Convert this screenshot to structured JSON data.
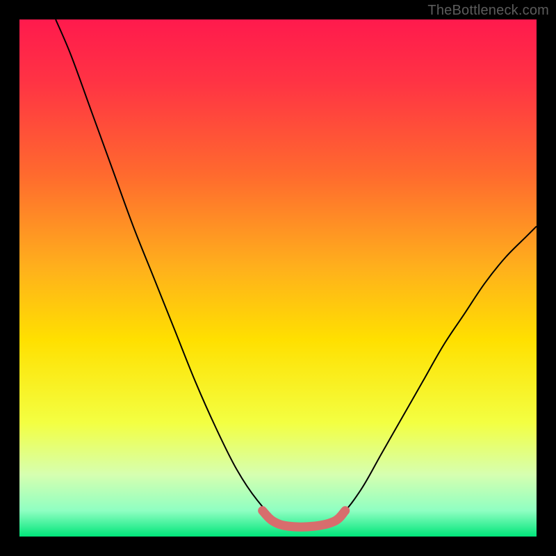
{
  "watermark": "TheBottleneck.com",
  "chart_data": {
    "type": "line",
    "title": "",
    "xlabel": "",
    "ylabel": "",
    "xlim": [
      0,
      100
    ],
    "ylim": [
      0,
      100
    ],
    "grid": false,
    "legend": false,
    "gradient_stops": [
      {
        "offset": 0.0,
        "color": "#ff1a4d"
      },
      {
        "offset": 0.12,
        "color": "#ff3344"
      },
      {
        "offset": 0.3,
        "color": "#ff6a2e"
      },
      {
        "offset": 0.48,
        "color": "#ffb01c"
      },
      {
        "offset": 0.62,
        "color": "#ffe000"
      },
      {
        "offset": 0.78,
        "color": "#f3ff42"
      },
      {
        "offset": 0.88,
        "color": "#d6ffb0"
      },
      {
        "offset": 0.95,
        "color": "#8fffc2"
      },
      {
        "offset": 1.0,
        "color": "#00e57a"
      }
    ],
    "series": [
      {
        "name": "bottleneck-curve",
        "stroke": "#000000",
        "stroke_width": 2,
        "points": [
          {
            "x": 7,
            "y": 100
          },
          {
            "x": 10,
            "y": 93
          },
          {
            "x": 14,
            "y": 82
          },
          {
            "x": 18,
            "y": 71
          },
          {
            "x": 22,
            "y": 60
          },
          {
            "x": 26,
            "y": 50
          },
          {
            "x": 30,
            "y": 40
          },
          {
            "x": 34,
            "y": 30
          },
          {
            "x": 38,
            "y": 21
          },
          {
            "x": 42,
            "y": 13
          },
          {
            "x": 46,
            "y": 7
          },
          {
            "x": 50,
            "y": 3
          },
          {
            "x": 54,
            "y": 2
          },
          {
            "x": 58,
            "y": 2
          },
          {
            "x": 62,
            "y": 4
          },
          {
            "x": 66,
            "y": 9
          },
          {
            "x": 70,
            "y": 16
          },
          {
            "x": 74,
            "y": 23
          },
          {
            "x": 78,
            "y": 30
          },
          {
            "x": 82,
            "y": 37
          },
          {
            "x": 86,
            "y": 43
          },
          {
            "x": 90,
            "y": 49
          },
          {
            "x": 94,
            "y": 54
          },
          {
            "x": 98,
            "y": 58
          },
          {
            "x": 100,
            "y": 60
          }
        ]
      },
      {
        "name": "optimal-zone-highlight",
        "stroke": "#d86d6d",
        "stroke_width": 13,
        "stroke_linecap": "round",
        "points": [
          {
            "x": 47,
            "y": 5
          },
          {
            "x": 49,
            "y": 3
          },
          {
            "x": 52,
            "y": 2
          },
          {
            "x": 57,
            "y": 2
          },
          {
            "x": 61,
            "y": 3
          },
          {
            "x": 63,
            "y": 5
          }
        ]
      }
    ]
  }
}
